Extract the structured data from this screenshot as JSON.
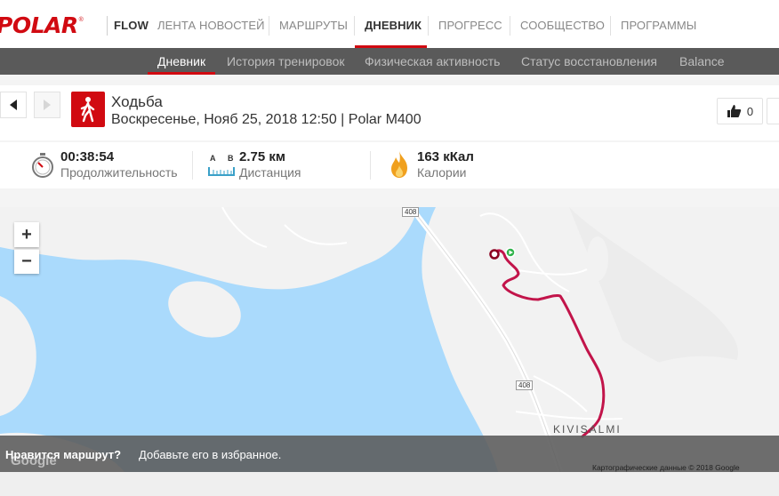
{
  "brand": {
    "logo_text": "POLAR",
    "product": "FLOW"
  },
  "nav": {
    "items": [
      {
        "label": "ЛЕНТА НОВОСТЕЙ"
      },
      {
        "label": "МАРШРУТЫ"
      },
      {
        "label": "ДНЕВНИК"
      },
      {
        "label": "ПРОГРЕСС"
      },
      {
        "label": "СООБЩЕСТВО"
      },
      {
        "label": "ПРОГРАММЫ"
      }
    ],
    "active": "ДНЕВНИК"
  },
  "subnav": {
    "items": [
      {
        "label": "Дневник"
      },
      {
        "label": "История тренировок"
      },
      {
        "label": "Физическая активность"
      },
      {
        "label": "Статус восстановления"
      },
      {
        "label": "Balance"
      }
    ],
    "active": "Дневник"
  },
  "activity": {
    "sport": "Ходьба",
    "icon": "walking-person-icon",
    "subtitle": "Воскресенье, Нояб 25, 2018 12:50 | Polar M400",
    "likes": "0"
  },
  "stats": {
    "duration": {
      "value": "00:38:54",
      "label": "Продолжительность",
      "icon": "stopwatch-icon"
    },
    "distance": {
      "value": "2.75 км",
      "label": "Дистанция",
      "icon": "ruler-ab-icon",
      "a": "A",
      "b": "B"
    },
    "calories": {
      "value": "163 кКал",
      "label": "Калории",
      "icon": "flame-icon"
    }
  },
  "map": {
    "zoom_in": "+",
    "zoom_out": "−",
    "road_label_1": "408",
    "road_label_2": "408",
    "place": "KIVISALMI",
    "footer_question": "Нравится маршрут?",
    "footer_text": "Добавьте его в избранное.",
    "credit": "Картографические данные © 2018 Google",
    "google": "Google",
    "colors": {
      "water": "#aadafc",
      "land": "#f2f2f2",
      "route": "#c2144a"
    }
  },
  "colors": {
    "brand": "#d10a11",
    "subnav_bg": "#5a5a5a"
  }
}
